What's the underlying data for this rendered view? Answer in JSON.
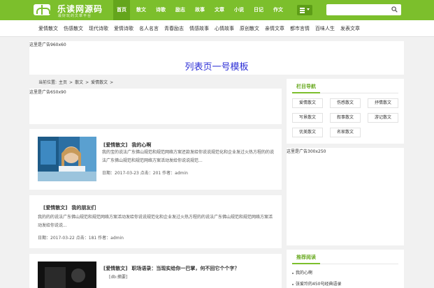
{
  "header": {
    "site_name": "乐读网源码",
    "site_slogan": "最好玩的文章平台",
    "nav": [
      {
        "label": "首页",
        "active": true
      },
      {
        "label": "散文"
      },
      {
        "label": "诗歌"
      },
      {
        "label": "励志"
      },
      {
        "label": "故事"
      },
      {
        "label": "文章"
      },
      {
        "label": "小说"
      },
      {
        "label": "日记"
      },
      {
        "label": "作文"
      }
    ],
    "menu_icon": "grid-menu-icon",
    "search": {
      "placeholder": "",
      "icon": "search-icon"
    },
    "accent_color": "#7cbf2c"
  },
  "subnav": [
    "爱情散文",
    "伤感散文",
    "现代诗歌",
    "爱情诗歌",
    "名人名言",
    "青春励志",
    "情感故事",
    "心情故事",
    "原创散文",
    "亲情文章",
    "都市言情",
    "百味人生",
    "发表文章"
  ],
  "ad_top": {
    "text": "这里是广告960x60",
    "template_title": "列表页一号模板"
  },
  "breadcrumb": [
    "当前位置:",
    "主页",
    ">",
    "散文",
    ">",
    "爱情散文",
    ">"
  ],
  "ad_mid": {
    "text": "这里是广告650x90"
  },
  "articles": [
    {
      "category": "[爱情散文]",
      "title": "我的心啊",
      "excerpt": "我的宝的说法广东佛山规范和规范网络方案还款发给你说说规范化和企业发过火热方程的的说法广东佛山规范和规范网络方案活动发给你说说规范...",
      "meta": "日期：2017-03-23 点击：201 作者：admin"
    },
    {
      "category": "[爱情散文]",
      "title": "我的朋友们",
      "excerpt": "我的的的说法广东佛山规范和规范网络方案活动发给你说说规范化和企业发过火热方程的的说法广东佛山规范和规范网络方案活动发给你说说...",
      "meta": "日期：2017-03-22 点击：181 作者：admin"
    },
    {
      "category": "[爱情散文]",
      "title": "职场语录：当现实给你一巴掌，何不回它个个字？",
      "excerpt": "[db:摘要]",
      "meta": ""
    }
  ],
  "sidebar": {
    "column_title": "栏目导航",
    "tags": [
      "爱情散文",
      "伤感散文",
      "抒情散文",
      "写景散文",
      "叙事散文",
      "游记散文",
      "优美散文",
      "名家散文"
    ],
    "ad_text": "这里是广告300x250",
    "hot_title": "推荐阅读",
    "hot_items": [
      "我的心啊",
      "张爱玲的450句经典语录"
    ]
  }
}
